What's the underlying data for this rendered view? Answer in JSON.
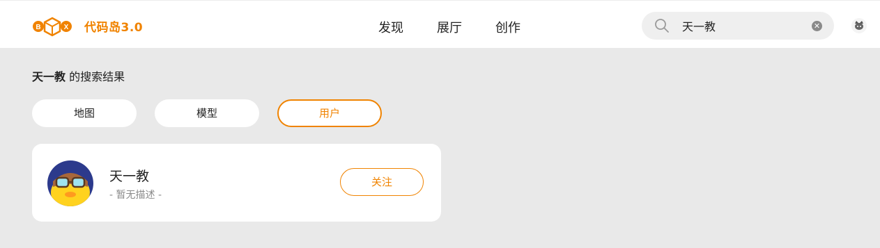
{
  "app": {
    "brand": "代码岛3.0",
    "logo_letters": [
      "B",
      "X"
    ]
  },
  "nav": {
    "items": [
      {
        "label": "发现"
      },
      {
        "label": "展厅"
      },
      {
        "label": "创作"
      }
    ]
  },
  "search": {
    "value": "天一教",
    "clear_glyph": "✕"
  },
  "results": {
    "keyword": "天一教",
    "suffix": " 的搜索结果"
  },
  "tabs": [
    {
      "label": "地图",
      "active": false
    },
    {
      "label": "模型",
      "active": false
    },
    {
      "label": "用户",
      "active": true
    }
  ],
  "users": [
    {
      "name": "天一教",
      "description": "- 暂无描述 -",
      "follow_label": "关注"
    }
  ],
  "colors": {
    "accent": "#f08300",
    "background": "#e9e9e9",
    "card": "#ffffff"
  },
  "icons": {
    "logo": "box-logo-icon",
    "search": "search-icon",
    "clear": "clear-icon",
    "header_avatar": "user-avatar-icon",
    "user_avatar": "duck-avatar-icon"
  }
}
